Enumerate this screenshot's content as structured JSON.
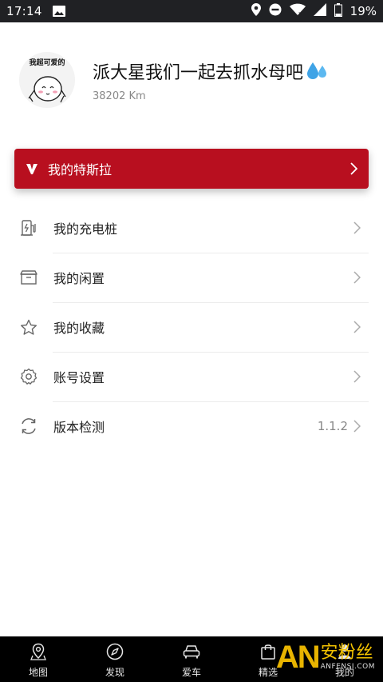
{
  "status_bar": {
    "time": "17:14",
    "battery": "19%",
    "icons": [
      "image-icon",
      "location-icon",
      "do-not-disturb-icon",
      "wifi-icon",
      "signal-icon",
      "battery-icon"
    ]
  },
  "profile": {
    "avatar_caption": "我超可爱的",
    "name": "派大星我们一起去抓水母吧",
    "name_emoji": "💦",
    "mileage": "38202 Km"
  },
  "tesla_card": {
    "label": "我的特斯拉",
    "background_color": "#b80f1f",
    "icon": "tesla-logo-icon"
  },
  "menu": [
    {
      "label": "我的充电桩",
      "icon": "charging-pile-icon",
      "value": ""
    },
    {
      "label": "我的闲置",
      "icon": "box-icon",
      "value": ""
    },
    {
      "label": "我的收藏",
      "icon": "star-icon",
      "value": ""
    },
    {
      "label": "账号设置",
      "icon": "gear-icon",
      "value": ""
    },
    {
      "label": "版本检测",
      "icon": "refresh-icon",
      "value": "1.1.2"
    }
  ],
  "tab_bar": {
    "tabs": [
      {
        "label": "地图",
        "icon": "map-pin-icon"
      },
      {
        "label": "发现",
        "icon": "compass-icon"
      },
      {
        "label": "爱车",
        "icon": "car-icon"
      },
      {
        "label": "精选",
        "icon": "bag-icon"
      },
      {
        "label": "我的",
        "icon": "person-icon"
      }
    ]
  },
  "watermark": {
    "logo": "AN",
    "text": "安粉丝",
    "url": "ANFENSI.COM"
  }
}
